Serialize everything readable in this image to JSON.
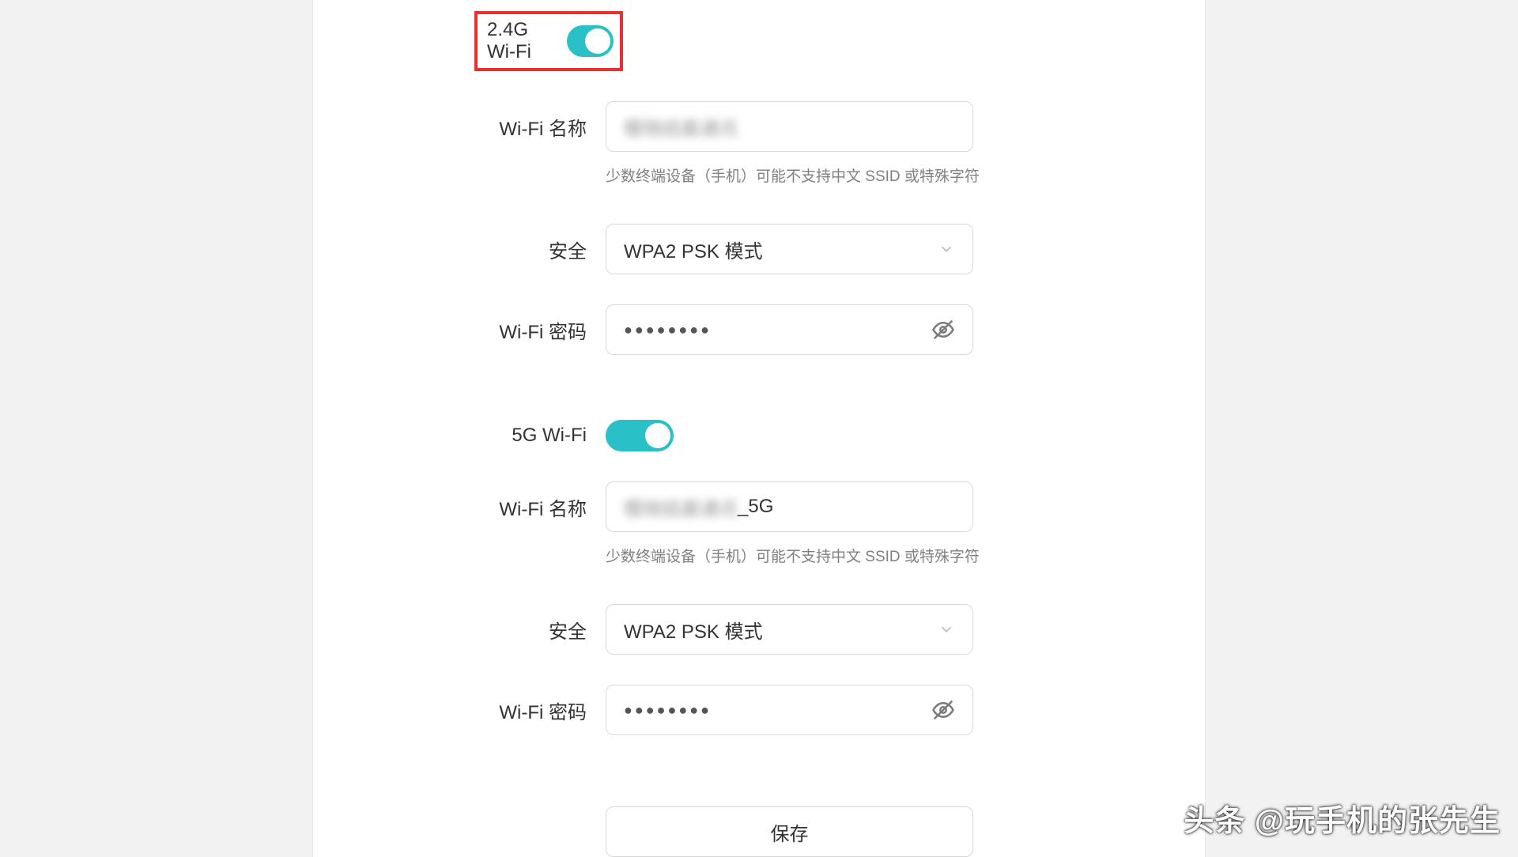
{
  "wifi24": {
    "toggle_label": "2.4G Wi-Fi",
    "name_label": "Wi-Fi 名称",
    "name_value": "樱晓结晨通讯",
    "ssid_hint": "少数终端设备（手机）可能不支持中文 SSID 或特殊字符",
    "security_label": "安全",
    "security_value": "WPA2 PSK 模式",
    "password_label": "Wi-Fi 密码",
    "password_mask": "●●●●●●●●"
  },
  "wifi5g": {
    "toggle_label": "5G Wi-Fi",
    "name_label": "Wi-Fi 名称",
    "name_value_blur": "樱晓结晨通讯",
    "name_value_suffix": "_5G",
    "ssid_hint": "少数终端设备（手机）可能不支持中文 SSID 或特殊字符",
    "security_label": "安全",
    "security_value": "WPA2 PSK 模式",
    "password_label": "Wi-Fi 密码",
    "password_mask": "●●●●●●●●"
  },
  "actions": {
    "save": "保存"
  },
  "watermark": "头条 @玩手机的张先生"
}
